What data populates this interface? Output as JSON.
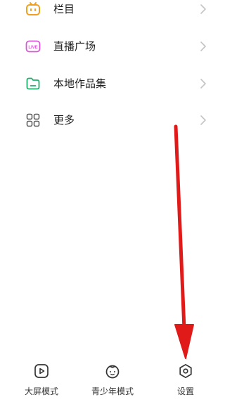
{
  "menu": {
    "items": [
      {
        "label": "栏目",
        "icon": "tv-icon"
      },
      {
        "label": "直播广场",
        "icon": "live-icon"
      },
      {
        "label": "本地作品集",
        "icon": "folder-icon"
      },
      {
        "label": "更多",
        "icon": "grid-icon"
      }
    ]
  },
  "bottom_bar": {
    "items": [
      {
        "label": "大屏模式",
        "icon": "play-screen-icon"
      },
      {
        "label": "青少年模式",
        "icon": "kid-face-icon"
      },
      {
        "label": "设置",
        "icon": "settings-gear-icon"
      }
    ]
  },
  "colors": {
    "tv_icon": "#f0a020",
    "live_icon": "#d65ad6",
    "folder_icon": "#1fae6a",
    "grid_icon": "#555555",
    "chevron": "#c4c4c4",
    "annotation_arrow": "#e01919"
  }
}
